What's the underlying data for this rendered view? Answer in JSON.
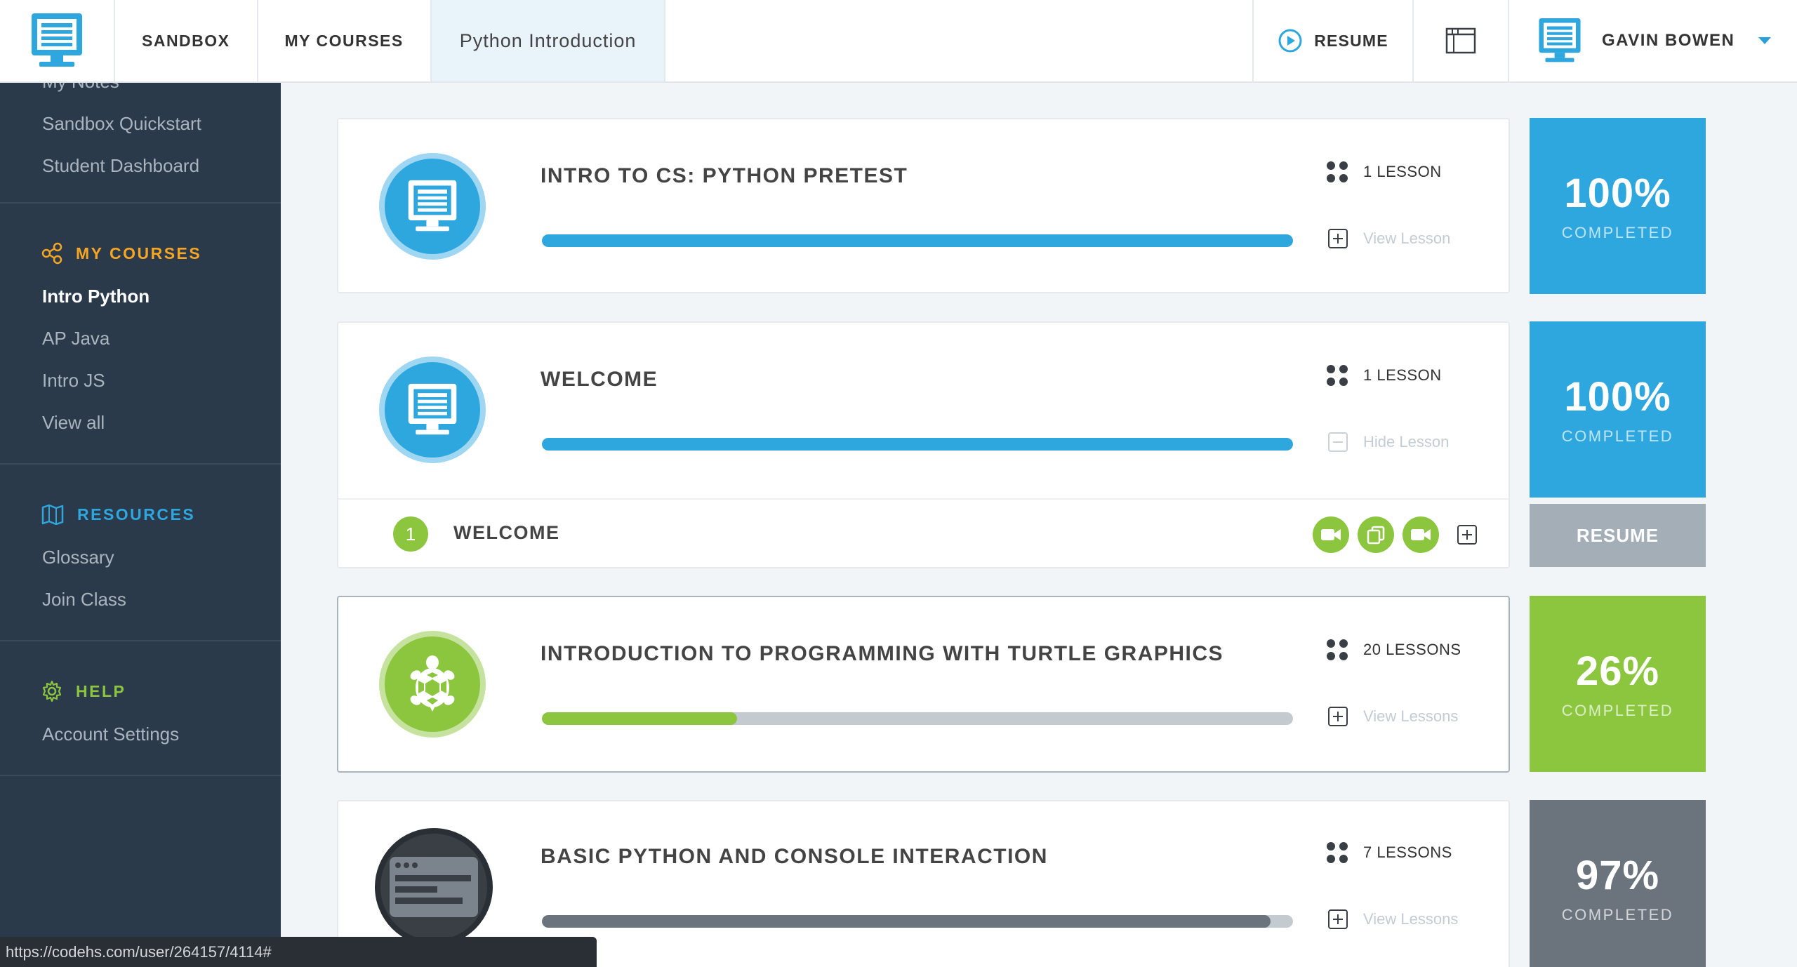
{
  "topbar": {
    "tabs": [
      {
        "label": "SANDBOX"
      },
      {
        "label": "MY COURSES"
      },
      {
        "label": "Python Introduction"
      }
    ],
    "resume_label": "RESUME",
    "user_name": "GAVIN BOWEN"
  },
  "sidebar": {
    "top_items": [
      "My Notes",
      "Sandbox Quickstart",
      "Student Dashboard"
    ],
    "my_courses": {
      "heading": "MY COURSES",
      "items": [
        "Intro Python",
        "AP Java",
        "Intro JS",
        "View all"
      ]
    },
    "resources": {
      "heading": "RESOURCES",
      "items": [
        "Glossary",
        "Join Class"
      ]
    },
    "help": {
      "heading": "HELP",
      "items": [
        "Account Settings"
      ]
    }
  },
  "courses": [
    {
      "title": "INTRO TO CS: PYTHON PRETEST",
      "lessons": "1 LESSON",
      "link": "View Lesson",
      "progress": 1.0,
      "percent": "100%",
      "percent_label": "COMPLETED",
      "color": "#2ea7df"
    },
    {
      "title": "WELCOME",
      "lessons": "1 LESSON",
      "link": "Hide Lesson",
      "progress": 1.0,
      "percent": "100%",
      "percent_label": "COMPLETED",
      "color": "#2ea7df",
      "expanded_lesson": {
        "number": "1",
        "name": "WELCOME"
      },
      "resume_label": "RESUME"
    },
    {
      "title": "INTRODUCTION TO PROGRAMMING WITH TURTLE GRAPHICS",
      "lessons": "20 LESSONS",
      "link": "View Lessons",
      "progress": 0.26,
      "percent": "26%",
      "percent_label": "COMPLETED",
      "color": "#8cc63f"
    },
    {
      "title": "BASIC PYTHON AND CONSOLE INTERACTION",
      "lessons": "7 LESSONS",
      "link": "View Lessons",
      "progress": 0.97,
      "percent": "97%",
      "percent_label": "COMPLETED",
      "color": "#6b747c"
    }
  ],
  "status_url": "https://codehs.com/user/264157/4114#"
}
